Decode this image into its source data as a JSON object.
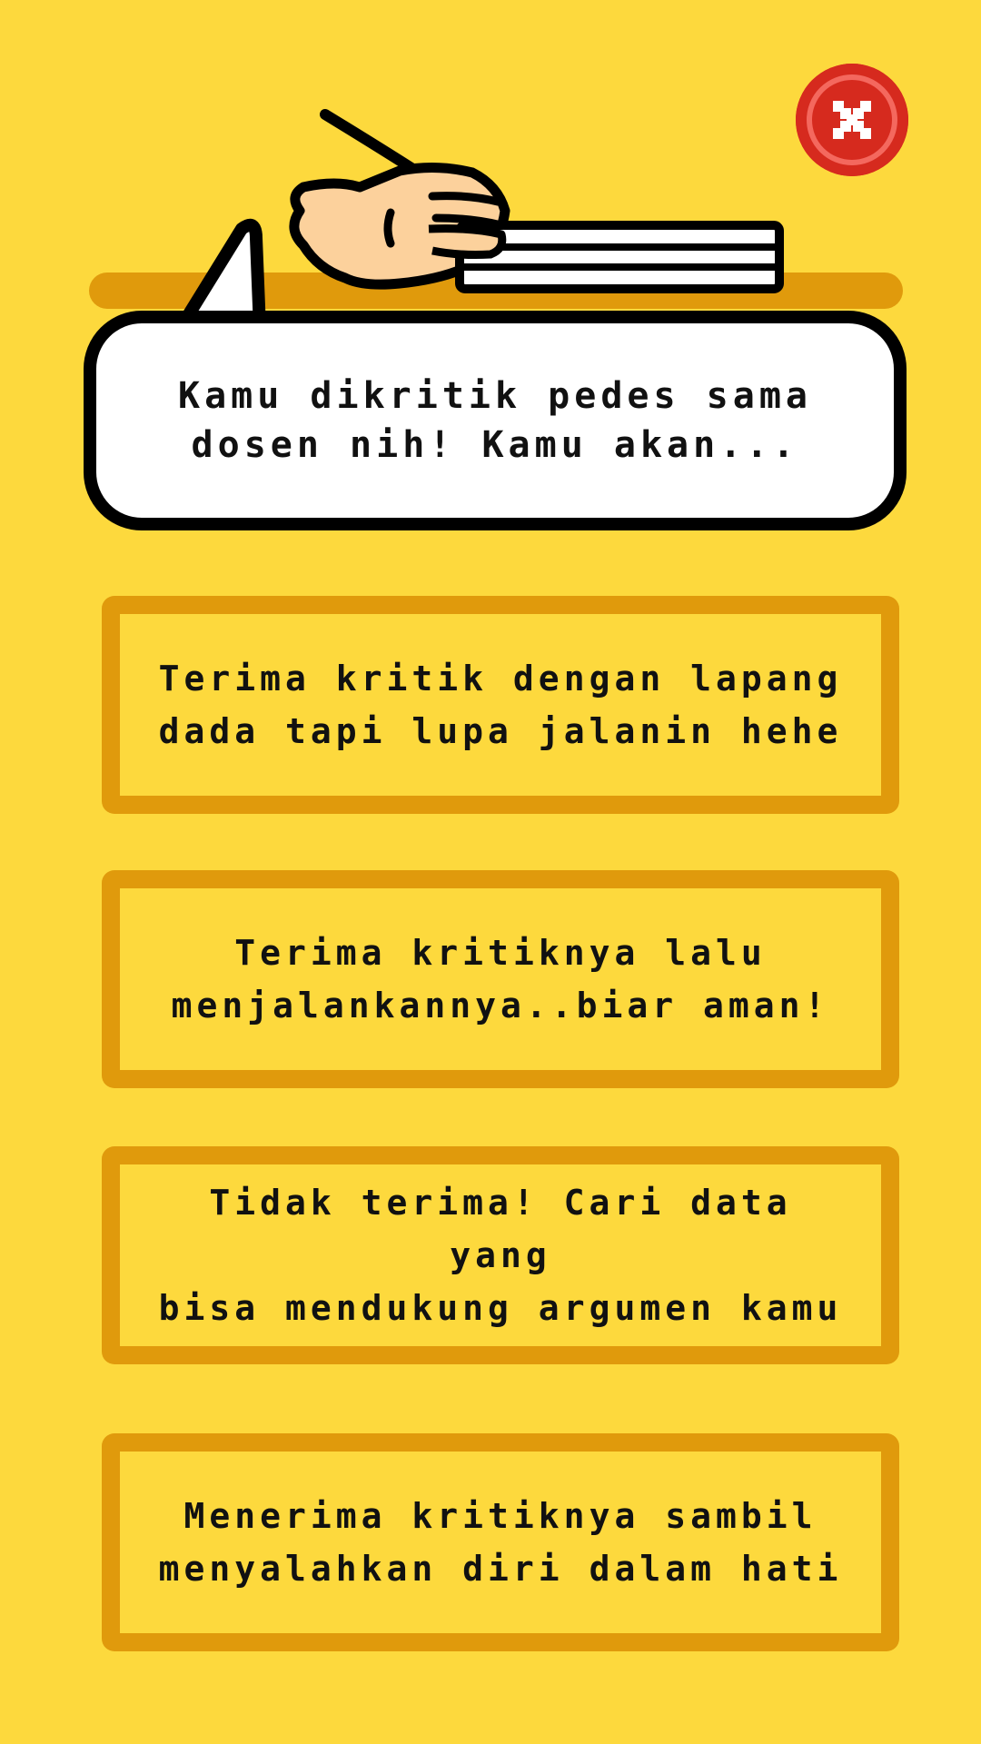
{
  "colors": {
    "background": "#FDD93D",
    "option_border": "#E09A0C",
    "close_button": "#D62A1E",
    "bubble_fill": "#FFFFFF",
    "outline": "#000000"
  },
  "close_button": {
    "icon": "close-icon"
  },
  "illustration": {
    "icon": "hand-writing-on-paper-icon"
  },
  "question": {
    "line1": "Kamu dikritik pedes sama",
    "line2": "dosen nih! Kamu akan..."
  },
  "options": [
    {
      "line1": "Terima kritik dengan lapang",
      "line2": "dada tapi lupa jalanin hehe"
    },
    {
      "line1": "Terima kritiknya lalu",
      "line2": "menjalankannya..biar aman!"
    },
    {
      "line1": "Tidak terima! Cari data yang",
      "line2": "bisa mendukung argumen kamu"
    },
    {
      "line1": "Menerima kritiknya sambil",
      "line2": "menyalahkan diri dalam hati"
    }
  ]
}
